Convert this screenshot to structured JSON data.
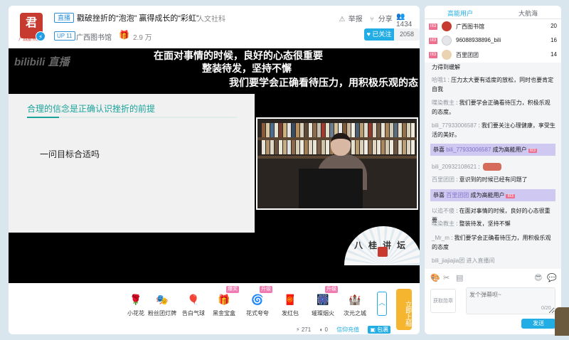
{
  "header": {
    "logo_text": "君",
    "logo_sub": "广西图书馆",
    "live_tag": "直播",
    "title": "戳破挫折的“泡泡” 赢得成长的“彩虹”",
    "category": "人文社科",
    "report_label": "举报",
    "share_label": "分享",
    "viewer_count": "1434",
    "up_level": "UP 11",
    "up_name": "广西图书馆",
    "fans_count": "2.9 万",
    "follow_label": "已关注",
    "follow_count": "2058"
  },
  "video": {
    "watermark": "bilibili 直播",
    "subtitles": [
      "在面对事情的时候，良好的心态很重要",
      "整装待发，坚持不懈",
      "我们要学会正确看待压力，用积极乐观的态"
    ],
    "slide_title": "合理的信念是正确认识挫折的前提",
    "slide_body": "一问目标合适吗",
    "fan_text": "八桂讲坛"
  },
  "gifts": [
    {
      "label": "小花花",
      "icon": "🌹",
      "badge": ""
    },
    {
      "label": "粉丝团灯牌",
      "icon": "🎭",
      "badge": ""
    },
    {
      "label": "告白气球",
      "icon": "🎈",
      "badge": ""
    },
    {
      "label": "黑金宝盒",
      "icon": "🎁",
      "badge": "爆奖"
    },
    {
      "label": "花式夸夸",
      "icon": "🌀",
      "badge": "升级"
    },
    {
      "label": "发红包",
      "icon": "🧧",
      "badge": ""
    },
    {
      "label": "璀璨烟火",
      "icon": "🎆",
      "badge": "升级"
    },
    {
      "label": "次元之城",
      "icon": "🏰",
      "badge": ""
    }
  ],
  "upstage_label": "立即上船",
  "wallet": {
    "gold": "271",
    "silver": "0",
    "recharge_label": "信仰充值",
    "bag_label": "包裹"
  },
  "panel": {
    "tab_high": "高能用户",
    "tab_fleet": "大航海",
    "ranks": [
      {
        "badge": "III3",
        "name": "广西图书馆",
        "score": "20"
      },
      {
        "badge": "III3",
        "name": "96088938896_bili",
        "score": "16"
      },
      {
        "badge": "III3",
        "name": "百里团团",
        "score": "14"
      }
    ],
    "chat": [
      {
        "type": "text",
        "name": "",
        "text": "力得到缓解"
      },
      {
        "type": "text",
        "name": "哈哦1",
        "text": "压力太大要有适度的放松，同时也要肯定自我"
      },
      {
        "type": "text",
        "name": "喋染教主",
        "text": "我们要学会正确看待压力，积极乐观的态度。"
      },
      {
        "type": "text",
        "name": "bili_77933006587",
        "text": "我们要关注心理健康，享受生活的美好。"
      },
      {
        "type": "notice",
        "prefix": "恭喜 ",
        "name": "bili_77933006587",
        "suffix": " 成为高能用户",
        "level": "III3"
      },
      {
        "type": "emoji",
        "name": "bili_20932108621",
        "text": ""
      },
      {
        "type": "text",
        "name": "百里团团",
        "text": "意识到的时候已经有问题了"
      },
      {
        "type": "notice",
        "prefix": "恭喜 ",
        "name": "百里团团",
        "suffix": " 成为高能用户",
        "level": "III3"
      },
      {
        "type": "text",
        "name": "以追不傻",
        "text": "在面对事情的时候，良好的心态很重要"
      },
      {
        "type": "text",
        "name": "喋染教主",
        "text": "整装待发，坚持不懈"
      },
      {
        "type": "text",
        "name": "_Mr_m",
        "text": "我们要学会正确看待压力，用积极乐观的态度"
      },
      {
        "type": "enter",
        "name": "bili_jiajiajia团",
        "text": "进入直播间"
      }
    ],
    "medal_label": "获取勋章",
    "input_placeholder": "发个弹幕呗~",
    "input_count": "0/20",
    "send_label": "发送"
  }
}
